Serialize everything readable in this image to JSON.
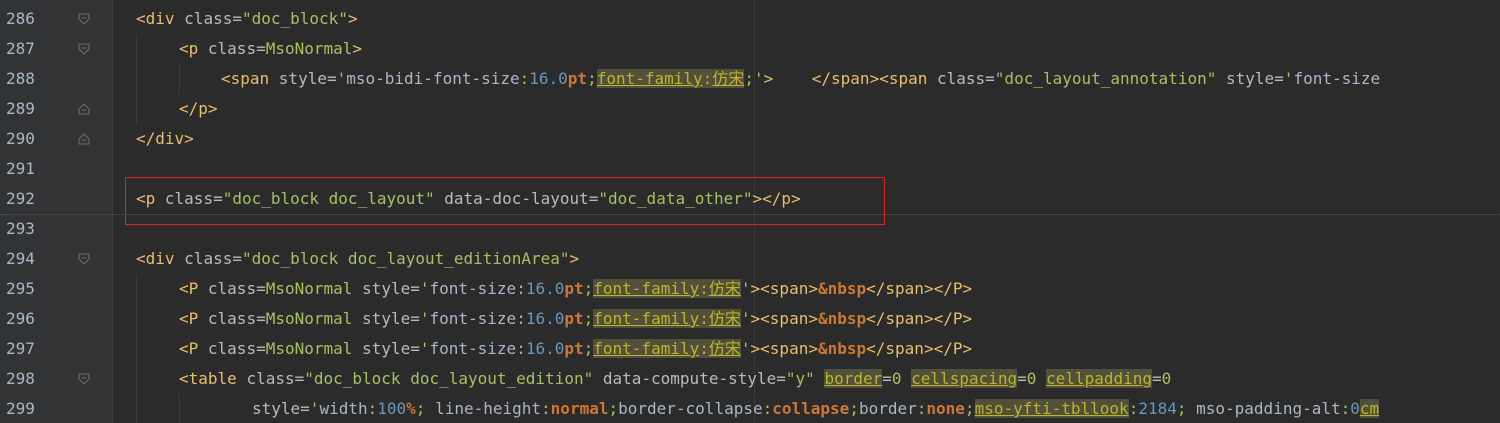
{
  "editor": {
    "lines": [
      {
        "number": "286",
        "text": "<div class=\"doc_block\">"
      },
      {
        "number": "287",
        "text": "<p class=MsoNormal>"
      },
      {
        "number": "288",
        "text": "<span style='mso-bidi-font-size:16.0pt;font-family:仿宋;'>    </span><span class=\"doc_layout_annotation\" style='font-size"
      },
      {
        "number": "289",
        "text": "</p>"
      },
      {
        "number": "290",
        "text": "</div>"
      },
      {
        "number": "291",
        "text": ""
      },
      {
        "number": "292",
        "text": "<p class=\"doc_block doc_layout\" data-doc-layout=\"doc_data_other\"></p>"
      },
      {
        "number": "293",
        "text": ""
      },
      {
        "number": "294",
        "text": "<div class=\"doc_block doc_layout_editionArea\">"
      },
      {
        "number": "295",
        "text": "<P class=MsoNormal style='font-size:16.0pt;font-family:仿宋'><span>&nbsp</span></P>"
      },
      {
        "number": "296",
        "text": "<P class=MsoNormal style='font-size:16.0pt;font-family:仿宋'><span>&nbsp</span></P>"
      },
      {
        "number": "297",
        "text": "<P class=MsoNormal style='font-size:16.0pt;font-family:仿宋'><span>&nbsp</span></P>"
      },
      {
        "number": "298",
        "text": "<table class=\"doc_block doc_layout_edition\" data-compute-style=\"y\" border=0 cellspacing=0 cellpadding=0"
      },
      {
        "number": "299",
        "text": "style='width:100%; line-height:normal;border-collapse:collapse;border:none;mso-yfti-tbllook:2184; mso-padding-alt:0cm"
      }
    ]
  },
  "colors": {
    "background": "#2b2b2b",
    "gutter": "#313335",
    "tag": "#e8bf6a",
    "attribute_value": "#a5c261",
    "highlight": "#52503a",
    "selection_box": "#e02020"
  }
}
